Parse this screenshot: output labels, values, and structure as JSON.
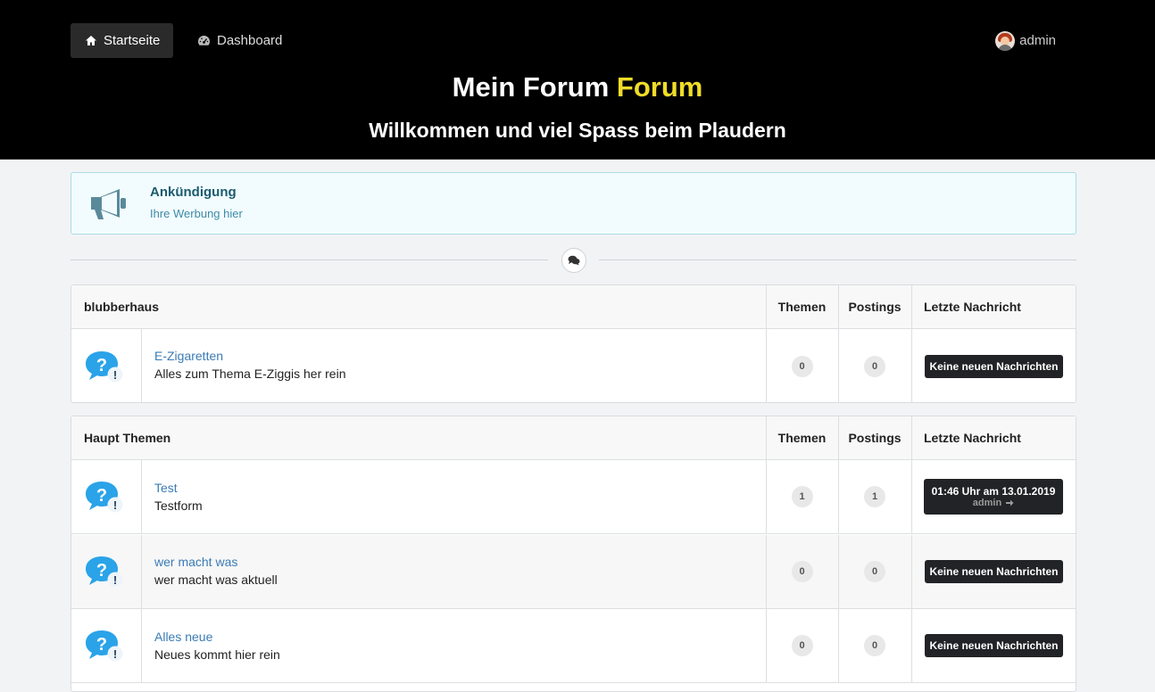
{
  "nav": {
    "home_label": "Startseite",
    "dashboard_label": "Dashboard",
    "user_name": "admin"
  },
  "header": {
    "title_main": "Mein Forum ",
    "title_accent": "Forum",
    "subtitle": "Willkommen und viel Spass beim Plaudern",
    "accent_color": "#f0dc28"
  },
  "announcement": {
    "title": "Ankündigung",
    "text": "Ihre Werbung hier"
  },
  "categories": [
    {
      "name": "blubberhaus",
      "col_topics": "Themen",
      "col_posts": "Postings",
      "col_last": "Letzte Nachricht",
      "forums": [
        {
          "title": "E-Zigaretten",
          "desc": "Alles zum Thema E-Ziggis her rein",
          "topics": "0",
          "posts": "0",
          "last": "Keine neuen Nachrichten"
        }
      ]
    },
    {
      "name": "Haupt Themen",
      "col_topics": "Themen",
      "col_posts": "Postings",
      "col_last": "Letzte Nachricht",
      "forums": [
        {
          "title": "Test",
          "desc": "Testform",
          "topics": "1",
          "posts": "1",
          "last_time": "01:46 Uhr am 13.01.2019",
          "last_user": "admin"
        },
        {
          "title": "wer macht was",
          "desc": "wer macht was aktuell",
          "topics": "0",
          "posts": "0",
          "last": "Keine neuen Nachrichten"
        },
        {
          "title": "Alles neue",
          "desc": "Neues kommt hier rein",
          "topics": "0",
          "posts": "0",
          "last": "Keine neuen Nachrichten"
        }
      ]
    }
  ]
}
